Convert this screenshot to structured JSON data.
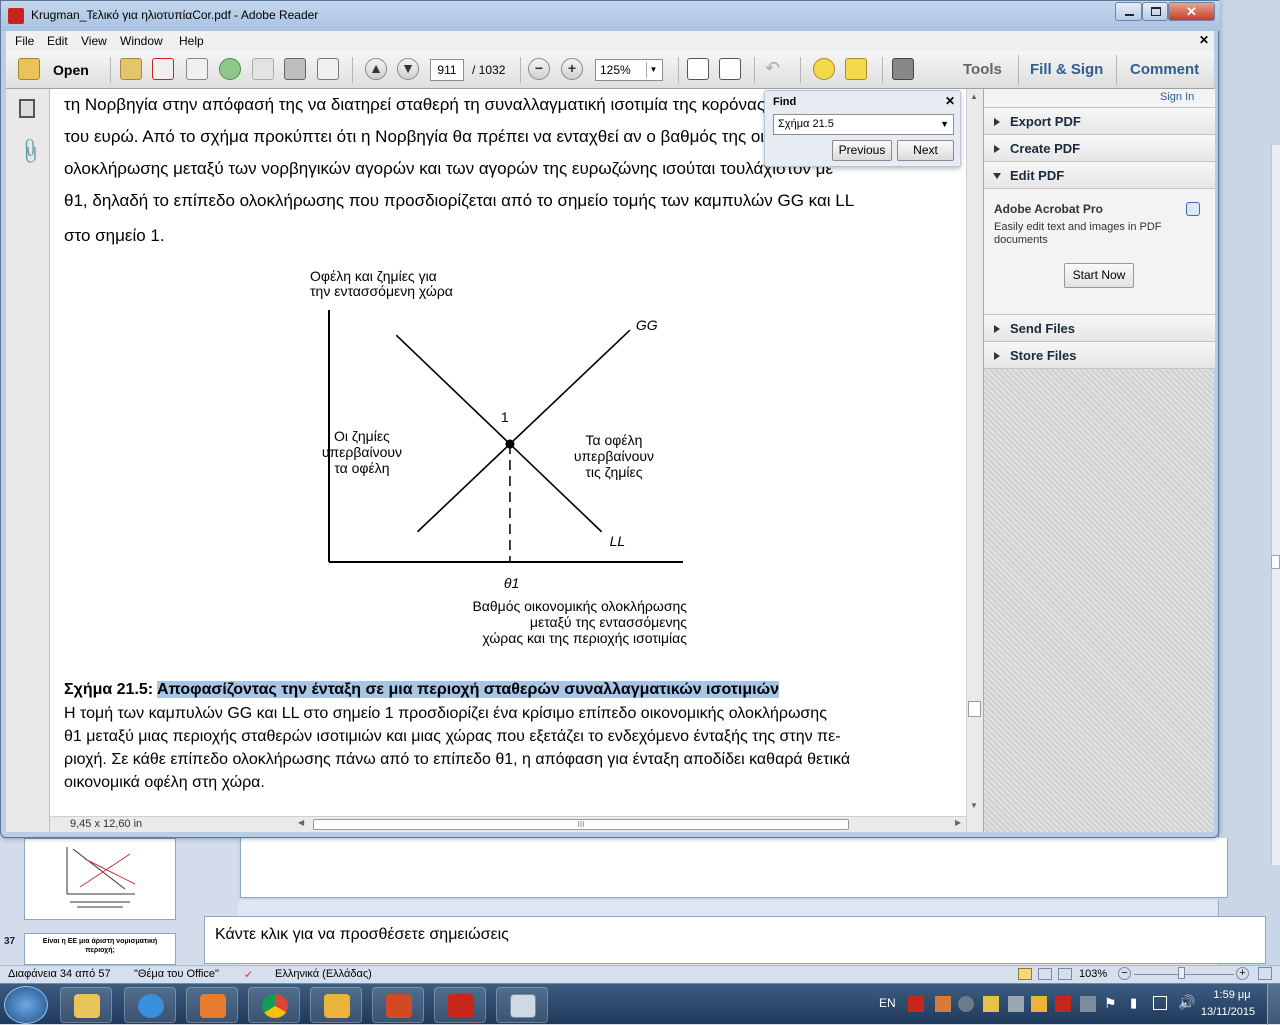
{
  "window": {
    "title": "Krugman_Τελικό για ηλιοτυπίαCor.pdf - Adobe Reader"
  },
  "menu": [
    "File",
    "Edit",
    "View",
    "Window",
    "Help"
  ],
  "toolbar": {
    "open": "Open",
    "page_current": "911",
    "page_total": "/ 1032",
    "zoom": "125%",
    "tools": "Tools",
    "fill_sign": "Fill & Sign",
    "comment": "Comment"
  },
  "find": {
    "title": "Find",
    "query": "Σχήμα 21.5",
    "previous": "Previous",
    "next": "Next"
  },
  "right_panel": {
    "sign_in": "Sign In",
    "sections": [
      "Export PDF",
      "Create PDF",
      "Edit PDF"
    ],
    "promo_title": "Adobe Acrobat Pro",
    "promo_text": "Easily edit text and images in PDF documents",
    "start_now": "Start Now",
    "sections_after": [
      "Send Files",
      "Store Files"
    ]
  },
  "document": {
    "lines": [
      "τη Νορβηγία στην απόφασή της να διατηρεί σταθερή τη συναλλαγματική ισοτιμία της κορόνας έναντι",
      "του ευρώ. Από το σχήμα προκύπτει ότι η Νορβηγία θα πρέπει να ενταχθεί αν ο βαθμός της οικονομικής",
      "ολοκλήρωσης μεταξύ των νορβηγικών αγορών και των αγορών της ευρωζώνης ισούται τουλάχιστον με",
      "θ1, δηλαδή το επίπεδο ολοκλήρωσης που προσδιορίζεται από το σημείο τομής των καμπυλών GG και LL",
      "στο σημείο 1."
    ],
    "caption_label": "Σχήμα 21.5:",
    "caption_title": "Αποφασίζοντας την ένταξη σε μια περιοχή σταθερών συναλλαγματικών ισοτιμιών",
    "caption_lines": [
      "Η τομή των καμπυλών GG και LL στο σημείο 1 προσδιορίζει ένα κρίσιμο επίπεδο οικονομικής ολοκλήρωσης",
      "θ1 μεταξύ μιας περιοχής σταθερών ισοτιμιών και μιας χώρας που εξετάζει το ενδεχόμενο ένταξής της στην πε-",
      "ριοχή. Σε κάθε επίπεδο ολοκλήρωσης πάνω από το επίπεδο θ1, η απόφαση για ένταξη αποδίδει καθαρά θετικά",
      "οικονομικά οφέλη στη χώρα."
    ],
    "page_size": "9,45 x 12,60 in"
  },
  "chart_data": {
    "type": "line",
    "title": "",
    "ylabel": "Οφέλη και ζημίες για την εντασσόμενη χώρα",
    "xlabel": "Βαθμός οικονομικής ολοκλήρωσης μεταξύ της εντασσόμενης χώρας και της περιοχής ισοτιμίας",
    "series": [
      {
        "name": "GG",
        "x": [
          0.25,
          0.85
        ],
        "y": [
          0.12,
          0.92
        ]
      },
      {
        "name": "LL",
        "x": [
          0.19,
          0.77
        ],
        "y": [
          0.9,
          0.12
        ]
      }
    ],
    "point_label": "1",
    "x_tick": "θ1",
    "left_note": "Οι ζημίες υπερβαίνουν τα οφέλη",
    "right_note": "Τα οφέλη υπερβαίνουν τις ζημίες"
  },
  "powerpoint": {
    "slide_number": "37",
    "thumb_title": "Είναι η ΕΕ μια άριστη νομισματική περιοχή;",
    "notes_placeholder": "Κάντε κλικ για να προσθέσετε σημειώσεις",
    "status_slide": "Διαφάνεια 34 από 57",
    "status_theme": "\"Θέμα του Office\"",
    "status_lang": "Ελληνικά (Ελλάδας)",
    "zoom": "103%"
  },
  "taskbar": {
    "lang": "EN",
    "time": "1:59 μμ",
    "date": "13/11/2015"
  }
}
